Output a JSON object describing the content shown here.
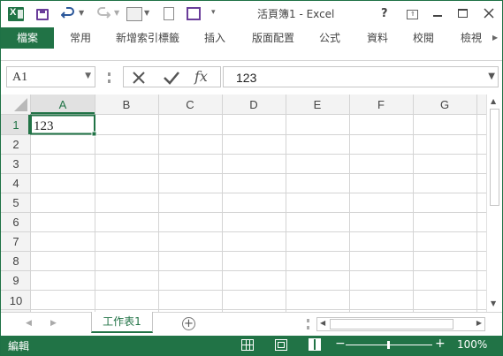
{
  "title": "活頁簿1 - Excel",
  "quick_access": {
    "save": "save-icon",
    "undo": "undo-icon",
    "redo": "redo-icon"
  },
  "window_controls": {
    "help": "?",
    "restore_ribbon": "ribbon-display-icon",
    "minimize": "minimize-icon",
    "maximize": "maximize-icon",
    "close": "close-icon"
  },
  "tabs": [
    "檔案",
    "常用",
    "新增索引標籤",
    "插入",
    "版面配置",
    "公式",
    "資料",
    "校閱",
    "檢視"
  ],
  "formula_bar": {
    "name_box": "A1",
    "fx": "fx",
    "content": "123"
  },
  "columns": [
    "A",
    "B",
    "C",
    "D",
    "E",
    "F",
    "G"
  ],
  "rows": [
    "1",
    "2",
    "3",
    "4",
    "5",
    "6",
    "7",
    "8",
    "9",
    "10"
  ],
  "cells": {
    "A1": "123"
  },
  "sheet_tabs": [
    "工作表1"
  ],
  "status": {
    "mode": "編輯",
    "zoom": "100%"
  },
  "colors": {
    "accent": "#217346",
    "header_bg": "#f3f3f3",
    "grid_line": "#d4d4d4",
    "active_header": "#e1e1e1"
  }
}
